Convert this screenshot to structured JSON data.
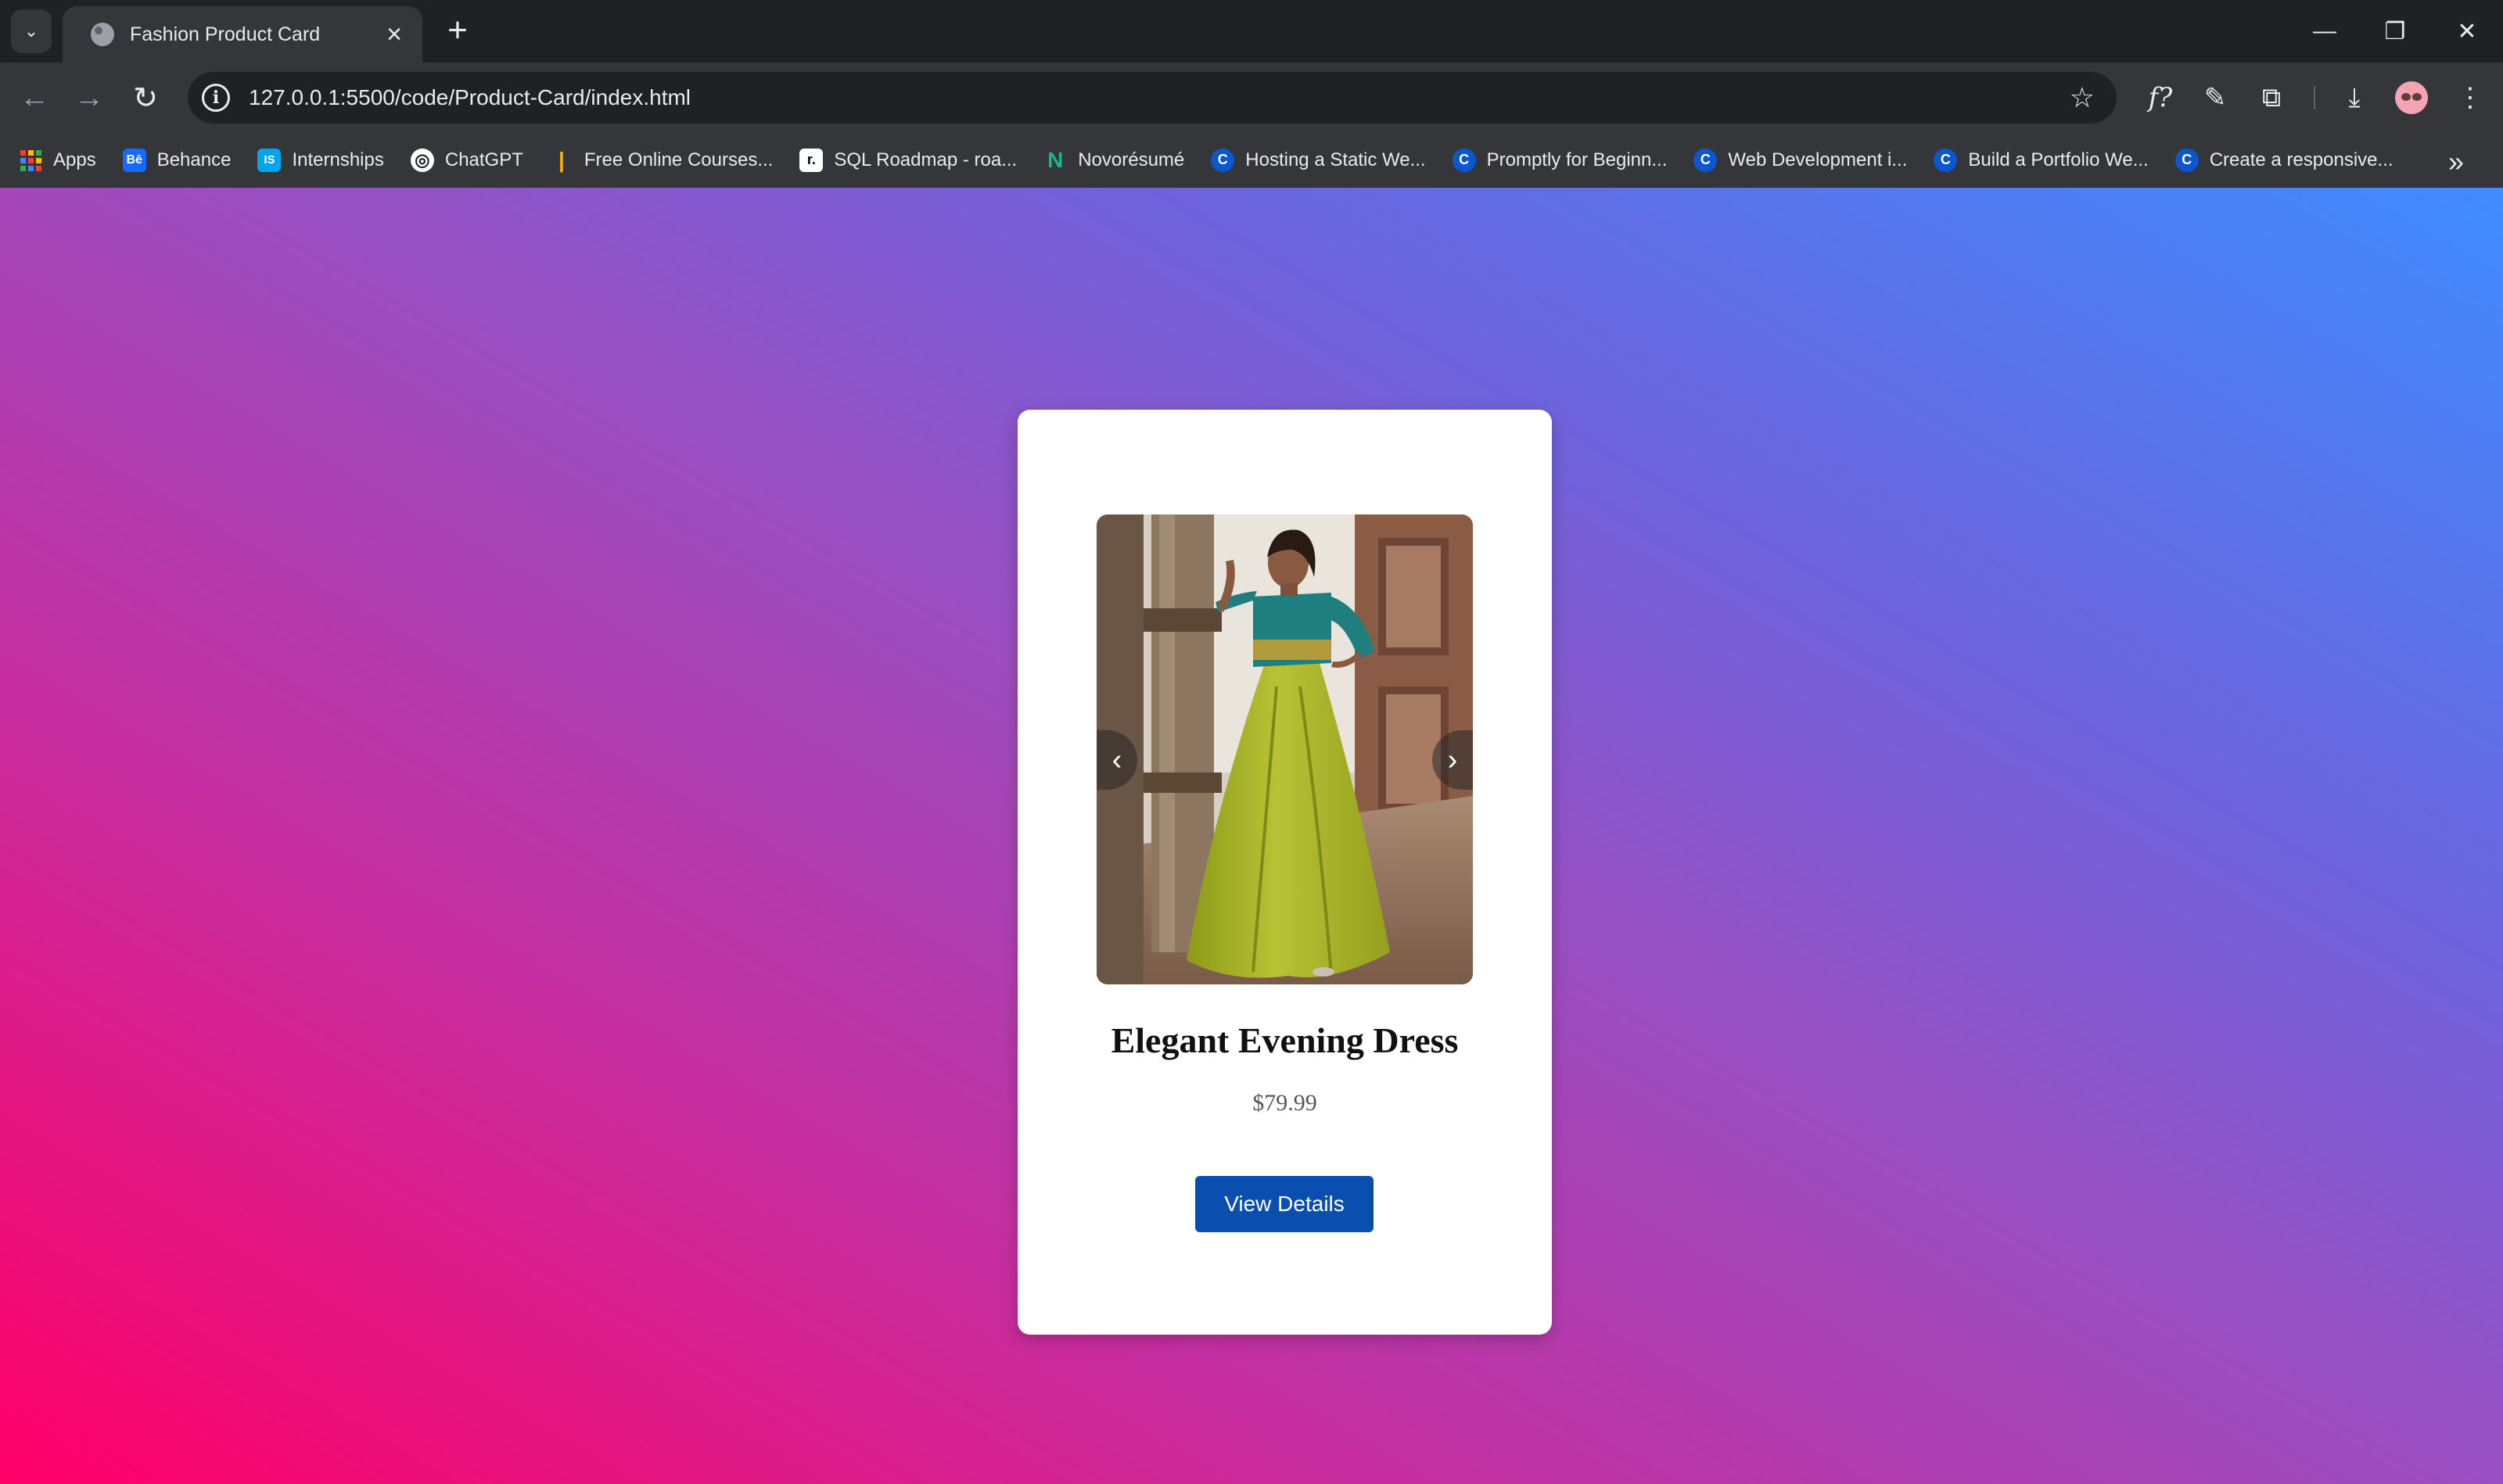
{
  "browser": {
    "tab": {
      "title": "Fashion Product Card",
      "close_icon": "close-icon"
    },
    "new_tab_label": "+",
    "address": {
      "url": "127.0.0.1:5500/code/Product-Card/index.html"
    },
    "bookmarks": [
      {
        "label": "Apps",
        "icon": "apps-grid-icon",
        "color": "#ea4335"
      },
      {
        "label": "Behance",
        "icon": "behance-icon",
        "color": "#1769ff",
        "glyph": "Bē"
      },
      {
        "label": "Internships",
        "icon": "internshala-icon",
        "color": "#00a5ec",
        "glyph": "IS"
      },
      {
        "label": "ChatGPT",
        "icon": "chatgpt-icon",
        "color": "#ffffff",
        "glyph": "◎"
      },
      {
        "label": "Free Online Courses...",
        "icon": "courses-icon",
        "color": "#f4b400",
        "glyph": "|"
      },
      {
        "label": "SQL Roadmap - roa...",
        "icon": "roadmap-icon",
        "color": "#ffffff",
        "glyph": "r."
      },
      {
        "label": "Novorésumé",
        "icon": "novoresume-icon",
        "color": "#1ab394",
        "glyph": "N"
      },
      {
        "label": "Hosting a Static We...",
        "icon": "c-icon",
        "color": "#0b57d0",
        "glyph": "C"
      },
      {
        "label": "Promptly for Beginn...",
        "icon": "c-icon",
        "color": "#0b57d0",
        "glyph": "C"
      },
      {
        "label": "Web Development i...",
        "icon": "c-icon",
        "color": "#0b57d0",
        "glyph": "C"
      },
      {
        "label": "Build a Portfolio We...",
        "icon": "c-icon",
        "color": "#0b57d0",
        "glyph": "C"
      },
      {
        "label": "Create a responsive...",
        "icon": "c-icon",
        "color": "#0b57d0",
        "glyph": "C"
      }
    ]
  },
  "page": {
    "background_colors": [
      "#ff0066",
      "#9a4ec0",
      "#3f8cff"
    ],
    "product": {
      "image_alt": "Woman in a lime green anarkali dress with a teal embroidered bodice",
      "title": "Elegant Evening Dress",
      "price": "$79.99",
      "button_label": "View Details",
      "prev_arrow": "‹",
      "next_arrow": "›"
    }
  }
}
